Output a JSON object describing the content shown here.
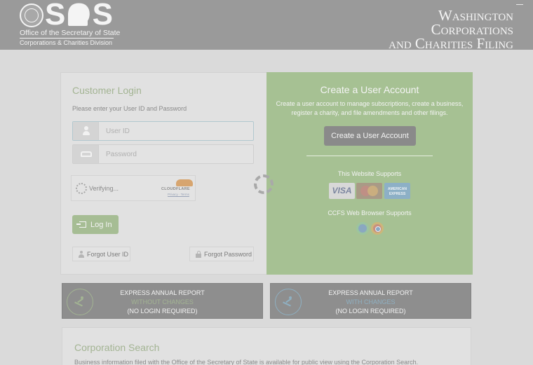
{
  "header": {
    "logo_letters": "SOS",
    "office_name": "Office of the Secretary of State",
    "division_name": "Corporations & Charities Division",
    "site_title_lines": [
      "Washington",
      "Corporations",
      "and Charities Filing"
    ]
  },
  "login": {
    "title": "Customer Login",
    "subtitle": "Please enter your User ID and Password",
    "userid_placeholder": "User ID",
    "password_placeholder": "Password",
    "captcha_status": "Verifying...",
    "captcha_brand": "CLOUDFLARE",
    "captcha_links": "Privacy · Terms",
    "login_button": "Log In",
    "forgot_userid": "Forgot User ID",
    "forgot_password": "Forgot Password"
  },
  "create_account": {
    "title": "Create a User Account",
    "description": "Create a user account to manage subscriptions, create a business, register a charity, and file amendments and other filings.",
    "button": "Create a User Account",
    "cards_heading": "This Website Supports",
    "cards": [
      "VISA",
      "MasterCard",
      "AMERICAN EXPRESS"
    ],
    "browsers_heading": "CCFS Web Browser Supports",
    "browsers": [
      "edge-icon",
      "chrome-icon"
    ]
  },
  "express": {
    "without": {
      "line1": "EXPRESS ANNUAL REPORT",
      "line2": "WITHOUT CHANGES",
      "line3": "(NO LOGIN REQUIRED)"
    },
    "with": {
      "line1": "EXPRESS ANNUAL REPORT",
      "line2": "WITH CHANGES",
      "line3": "(NO LOGIN REQUIRED)"
    }
  },
  "search": {
    "title": "Corporation Search",
    "description": "Business information filed with the Office of the Secretary of State is available for public view using the Corporation Search."
  },
  "colors": {
    "header_bg": "#9a9a9a",
    "accent_green": "#a6c193",
    "accent_blue": "#8fb0c2",
    "overlay": "#dadada"
  }
}
